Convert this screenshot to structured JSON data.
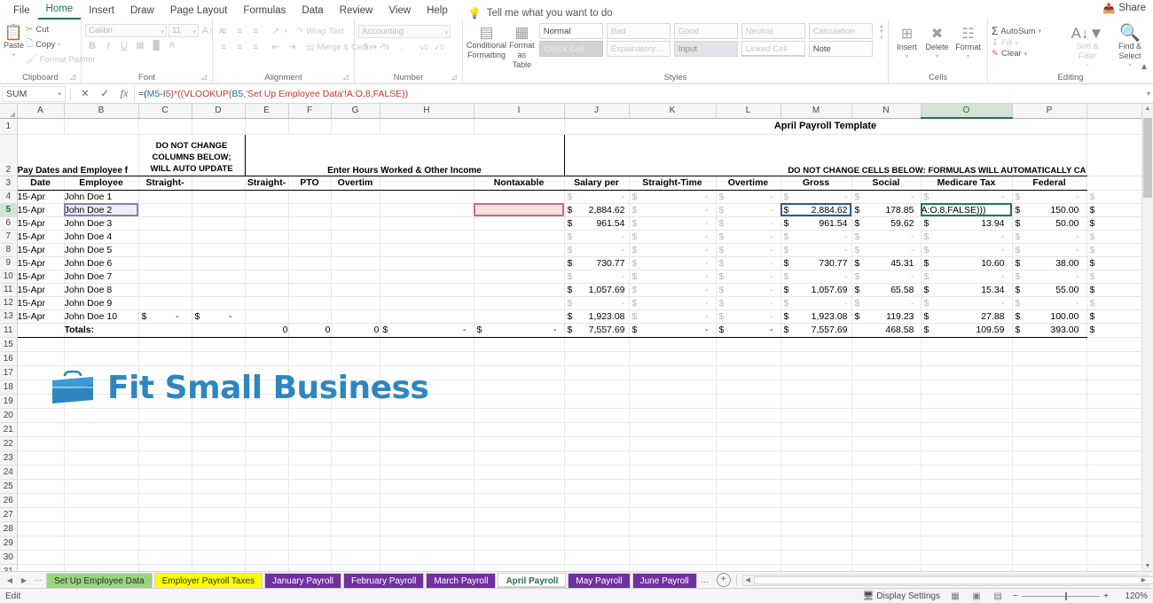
{
  "app": {
    "ribbon_tabs": [
      "File",
      "Home",
      "Insert",
      "Draw",
      "Page Layout",
      "Formulas",
      "Data",
      "Review",
      "View",
      "Help"
    ],
    "active_ribbon_tab": "Home",
    "tell_me": "Tell me what you want to do",
    "share_label": "Share",
    "accent_color": "#217346"
  },
  "ribbon": {
    "clipboard": {
      "label": "Clipboard",
      "paste": "Paste",
      "cut": "Cut",
      "copy": "Copy",
      "format_painter": "Format Painter"
    },
    "font": {
      "label": "Font",
      "font_name": "Calibri",
      "font_size": "11",
      "bold": "B",
      "italic": "I",
      "underline": "U",
      "grow_font": "A",
      "shrink_font": "A"
    },
    "alignment": {
      "label": "Alignment",
      "wrap_text": "Wrap Text",
      "merge_center": "Merge & Center"
    },
    "number": {
      "label": "Number",
      "format": "Accounting",
      "currency": "$",
      "percent": "%",
      "comma": ","
    },
    "styles": {
      "label": "Styles",
      "conditional_formatting": "Conditional Formatting",
      "format_as_table": "Format as Table",
      "cells": [
        "Normal",
        "Bad",
        "Good",
        "Neutral",
        "Calculation",
        "Check Cell",
        "Explanatory ...",
        "Input",
        "Linked Cell",
        "Note"
      ]
    },
    "cells": {
      "label": "Cells",
      "insert": "Insert",
      "delete": "Delete",
      "format": "Format"
    },
    "editing": {
      "label": "Editing",
      "autosum": "AutoSum",
      "fill": "Fill",
      "clear": "Clear",
      "sort_filter": "Sort & Filter",
      "find_select": "Find & Select"
    }
  },
  "formula_bar": {
    "name_box": "SUM",
    "cancel_icon": "✕",
    "enter_icon": "✓",
    "fx_icon": "fx",
    "formula_parts": [
      {
        "text": "=(",
        "color": "dark"
      },
      {
        "text": "M5",
        "color": "blue"
      },
      {
        "text": "-",
        "color": "dark"
      },
      {
        "text": "I5",
        "color": "purple"
      },
      {
        "text": ")*((VLOOKUP(",
        "color": "red"
      },
      {
        "text": "B5",
        "color": "blue"
      },
      {
        "text": ",'Set Up Employee Data'!A:O,8,FALSE))",
        "color": "red"
      }
    ],
    "formula_full": "=(M5-I5)*((VLOOKUP(B5,'Set Up Employee Data'!A:O,8,FALSE))"
  },
  "grid": {
    "columns": [
      "A",
      "B",
      "C",
      "D",
      "E",
      "F",
      "G",
      "H",
      "I",
      "J",
      "K",
      "L",
      "M",
      "N",
      "O",
      "P"
    ],
    "selected_column": "O",
    "selected_row": 5,
    "row_numbers": [
      1,
      2,
      3,
      4,
      5,
      6,
      7,
      8,
      9,
      10,
      11,
      12,
      13,
      14,
      15,
      16,
      17,
      18,
      19,
      20,
      21,
      22,
      23,
      24,
      25,
      26,
      27,
      28,
      29,
      30,
      31
    ],
    "title_banner": "April Payroll Template",
    "section_headers": {
      "pay_dates": "Pay Dates and Employee f",
      "do_not_change_left": [
        "DO NOT CHANGE",
        "COLUMNS BELOW;",
        "WILL AUTO UPDATE"
      ],
      "enter_hours": "Enter Hours Worked & Other Income",
      "do_not_change_right": "DO NOT CHANGE CELLS BELOW: FORMULAS WILL AUTOMATICALLY CA"
    },
    "headers_row3": {
      "A": "Date",
      "B": "Employee",
      "C": "Straight-",
      "D": "",
      "E": "Straight-",
      "F": "PTO",
      "G": "Overtim",
      "H": "",
      "I": "Nontaxable",
      "J": "Salary per",
      "K": "Straight-Time",
      "L": "Overtime",
      "M": "Gross",
      "N": "Social",
      "O": "Medicare Tax",
      "P": "Federal"
    },
    "rows": [
      {
        "row": 4,
        "date": "15-Apr",
        "employee": "John Doe 1",
        "c": "",
        "d": "",
        "e": "",
        "f": "",
        "g": "",
        "h": "",
        "i": "",
        "j": "-",
        "k": "-",
        "l": "-",
        "m": "-",
        "n": "-",
        "o": "-",
        "p": "-",
        "zero": true
      },
      {
        "row": 5,
        "date": "15-Apr",
        "employee": "John Doe 2",
        "c": "",
        "d": "",
        "e": "",
        "f": "",
        "g": "",
        "h": "",
        "i": "",
        "j": "2,884.62",
        "k": "-",
        "l": "-",
        "m": "2,884.62",
        "n": "178.85",
        "o": "A:O,8,FALSE)))",
        "p": "150.00",
        "zero": false
      },
      {
        "row": 6,
        "date": "15-Apr",
        "employee": "John Doe 3",
        "c": "",
        "d": "",
        "e": "",
        "f": "",
        "g": "",
        "h": "",
        "i": "",
        "j": "961.54",
        "k": "-",
        "l": "-",
        "m": "961.54",
        "n": "59.62",
        "o": "13.94",
        "p": "50.00",
        "zero": false
      },
      {
        "row": 7,
        "date": "15-Apr",
        "employee": "John Doe 4",
        "c": "",
        "d": "",
        "e": "",
        "f": "",
        "g": "",
        "h": "",
        "i": "",
        "j": "-",
        "k": "-",
        "l": "-",
        "m": "-",
        "n": "-",
        "o": "-",
        "p": "-",
        "zero": true
      },
      {
        "row": 8,
        "date": "15-Apr",
        "employee": "John Doe 5",
        "c": "",
        "d": "",
        "e": "",
        "f": "",
        "g": "",
        "h": "",
        "i": "",
        "j": "-",
        "k": "-",
        "l": "-",
        "m": "-",
        "n": "-",
        "o": "-",
        "p": "-",
        "zero": true
      },
      {
        "row": 9,
        "date": "15-Apr",
        "employee": "John Doe 6",
        "c": "",
        "d": "",
        "e": "",
        "f": "",
        "g": "",
        "h": "",
        "i": "",
        "j": "730.77",
        "k": "-",
        "l": "-",
        "m": "730.77",
        "n": "45.31",
        "o": "10.60",
        "p": "38.00",
        "zero": false
      },
      {
        "row": 10,
        "date": "15-Apr",
        "employee": "John Doe 7",
        "c": "",
        "d": "",
        "e": "",
        "f": "",
        "g": "",
        "h": "",
        "i": "",
        "j": "-",
        "k": "-",
        "l": "-",
        "m": "-",
        "n": "-",
        "o": "-",
        "p": "-",
        "zero": true
      },
      {
        "row": 11,
        "date": "15-Apr",
        "employee": "John Doe 8",
        "c": "",
        "d": "",
        "e": "",
        "f": "",
        "g": "",
        "h": "",
        "i": "",
        "j": "1,057.69",
        "k": "-",
        "l": "-",
        "m": "1,057.69",
        "n": "65.58",
        "o": "15.34",
        "p": "55.00",
        "zero": false
      },
      {
        "row": 12,
        "date": "15-Apr",
        "employee": "John Doe 9",
        "c": "",
        "d": "",
        "e": "",
        "f": "",
        "g": "",
        "h": "",
        "i": "",
        "j": "-",
        "k": "-",
        "l": "-",
        "m": "-",
        "n": "-",
        "o": "-",
        "p": "-",
        "zero": true
      },
      {
        "row": 13,
        "date": "15-Apr",
        "employee": "John Doe 10",
        "c": "-",
        "d": "-",
        "e": "",
        "f": "",
        "g": "",
        "h": "",
        "i": "",
        "j": "1,923.08",
        "k": "-",
        "l": "-",
        "m": "1,923.08",
        "n": "119.23",
        "o": "27.88",
        "p": "100.00",
        "zero": false
      }
    ],
    "totals": {
      "label": "Totals:",
      "e": "0",
      "f": "0",
      "g": "0",
      "h": "-",
      "i": "-",
      "j": "7,557.69",
      "k": "-",
      "l": "-",
      "m": "7,557.69",
      "n": "468.58",
      "o": "109.59",
      "p": "393.00"
    },
    "currency_symbol": "$",
    "dash": "-",
    "logo_text": "Fit Small Business",
    "logo_color": "#2e86c1"
  },
  "sheet_tabs": {
    "tabs": [
      {
        "label": "Set Up Employee Data",
        "color": "#9ad47f",
        "text": "#2b2b2b",
        "active": false
      },
      {
        "label": "Employer Payroll Taxes",
        "color": "#fdfd00",
        "text": "#2b2b2b",
        "active": false
      },
      {
        "label": "January Payroll",
        "color": "#7030a0",
        "text": "#ffffff",
        "active": false
      },
      {
        "label": "February Payroll",
        "color": "#7030a0",
        "text": "#ffffff",
        "active": false
      },
      {
        "label": "March Payroll",
        "color": "#7030a0",
        "text": "#ffffff",
        "active": false
      },
      {
        "label": "April Payroll",
        "color": "#ffffff",
        "text": "#217346",
        "active": true
      },
      {
        "label": "May Payroll",
        "color": "#7030a0",
        "text": "#ffffff",
        "active": false
      },
      {
        "label": "June Payroll",
        "color": "#7030a0",
        "text": "#ffffff",
        "active": false
      }
    ],
    "overflow": "…",
    "add_sheet": "+"
  },
  "status_bar": {
    "mode": "Edit",
    "display_settings": "Display Settings",
    "zoom": "120%",
    "views": [
      "normal-view",
      "page-layout-view",
      "page-break-view"
    ]
  }
}
